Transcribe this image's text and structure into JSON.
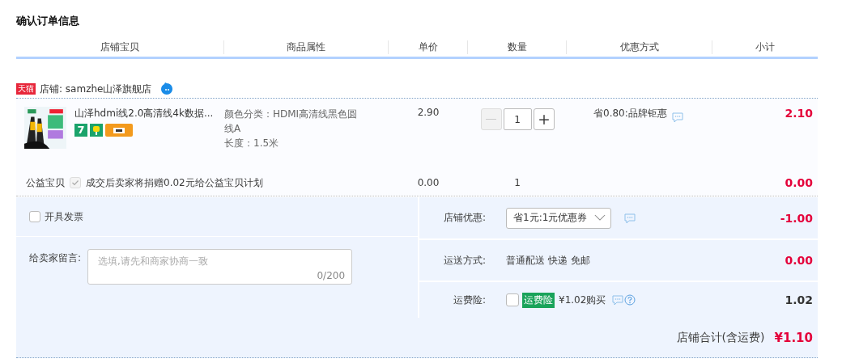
{
  "title": "确认订单信息",
  "columns": [
    "店铺宝贝",
    "商品属性",
    "单价",
    "数量",
    "优惠方式",
    "小计"
  ],
  "shop": {
    "logo": "天猫",
    "name": "店铺: samzhe山泽旗舰店"
  },
  "item": {
    "title": "山泽hdmi线2.0高清线4k数据...",
    "badges": [
      {
        "kind": "seven",
        "text": "7"
      },
      {
        "kind": "plug"
      },
      {
        "kind": "card"
      }
    ],
    "props": [
      "颜色分类：HDMI高清线黑色圆线A",
      "长度：1.5米"
    ],
    "price": "2.90",
    "quantity": "1",
    "minus_disabled": true,
    "discount": "省0.80:品牌钜惠",
    "subtotal": "2.10"
  },
  "charity": {
    "label": "公益宝贝",
    "checked": true,
    "disabled": true,
    "text": "成交后卖家将捐赠0.02元给公益宝贝计划",
    "price": "0.00",
    "quantity": "1",
    "subtotal": "0.00"
  },
  "invoice": {
    "label": "开具发票",
    "checked": false
  },
  "message": {
    "label": "给卖家留言:",
    "placeholder": "选填,请先和商家协商一致",
    "counter": "0/200"
  },
  "coupon": {
    "label": "店铺优惠:",
    "value": "省1元:1元优惠券",
    "amount": "-1.00"
  },
  "shipping": {
    "label": "运送方式:",
    "value": "普通配送 快递 免邮",
    "amount": "0.00"
  },
  "insurance": {
    "label": "运费险:",
    "checked": false,
    "tag": "运费险",
    "price": "¥1.02购买",
    "amount": "1.02"
  },
  "total": {
    "label": "店铺合计(含运费)",
    "amount": "¥1.10"
  }
}
